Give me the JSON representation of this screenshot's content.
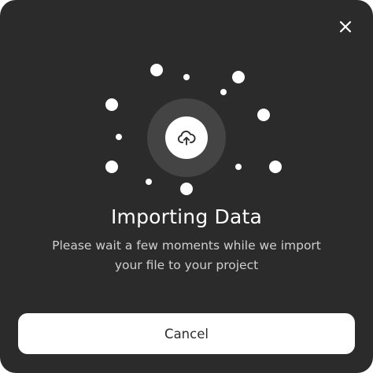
{
  "dialog": {
    "title": "Importing Data",
    "message": "Please wait a few moments while we import your file to your project",
    "cancel_label": "Cancel",
    "icons": {
      "close": "close-icon",
      "upload": "cloud-upload-icon"
    },
    "colors": {
      "background": "#2b2b2b",
      "ring": "#444444",
      "accent": "#ffffff",
      "text_muted": "#cfcfcf"
    }
  }
}
